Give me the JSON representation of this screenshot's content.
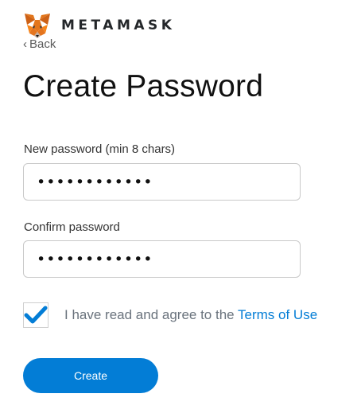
{
  "header": {
    "brand": "METAMASK",
    "back_label": "Back"
  },
  "page": {
    "title": "Create Password"
  },
  "form": {
    "new_password_label": "New password (min 8 chars)",
    "new_password_value": "••••••••••••",
    "confirm_password_label": "Confirm password",
    "confirm_password_value": "••••••••••••",
    "terms_checked": true,
    "terms_text": "I have read and agree to the ",
    "terms_link": "Terms of Use",
    "create_label": "Create"
  },
  "colors": {
    "accent": "#037dd6",
    "fox_orange": "#e2761b"
  },
  "icons": {
    "logo": "metamask-fox-icon",
    "back": "chevron-left-icon",
    "check": "checkmark-icon"
  }
}
